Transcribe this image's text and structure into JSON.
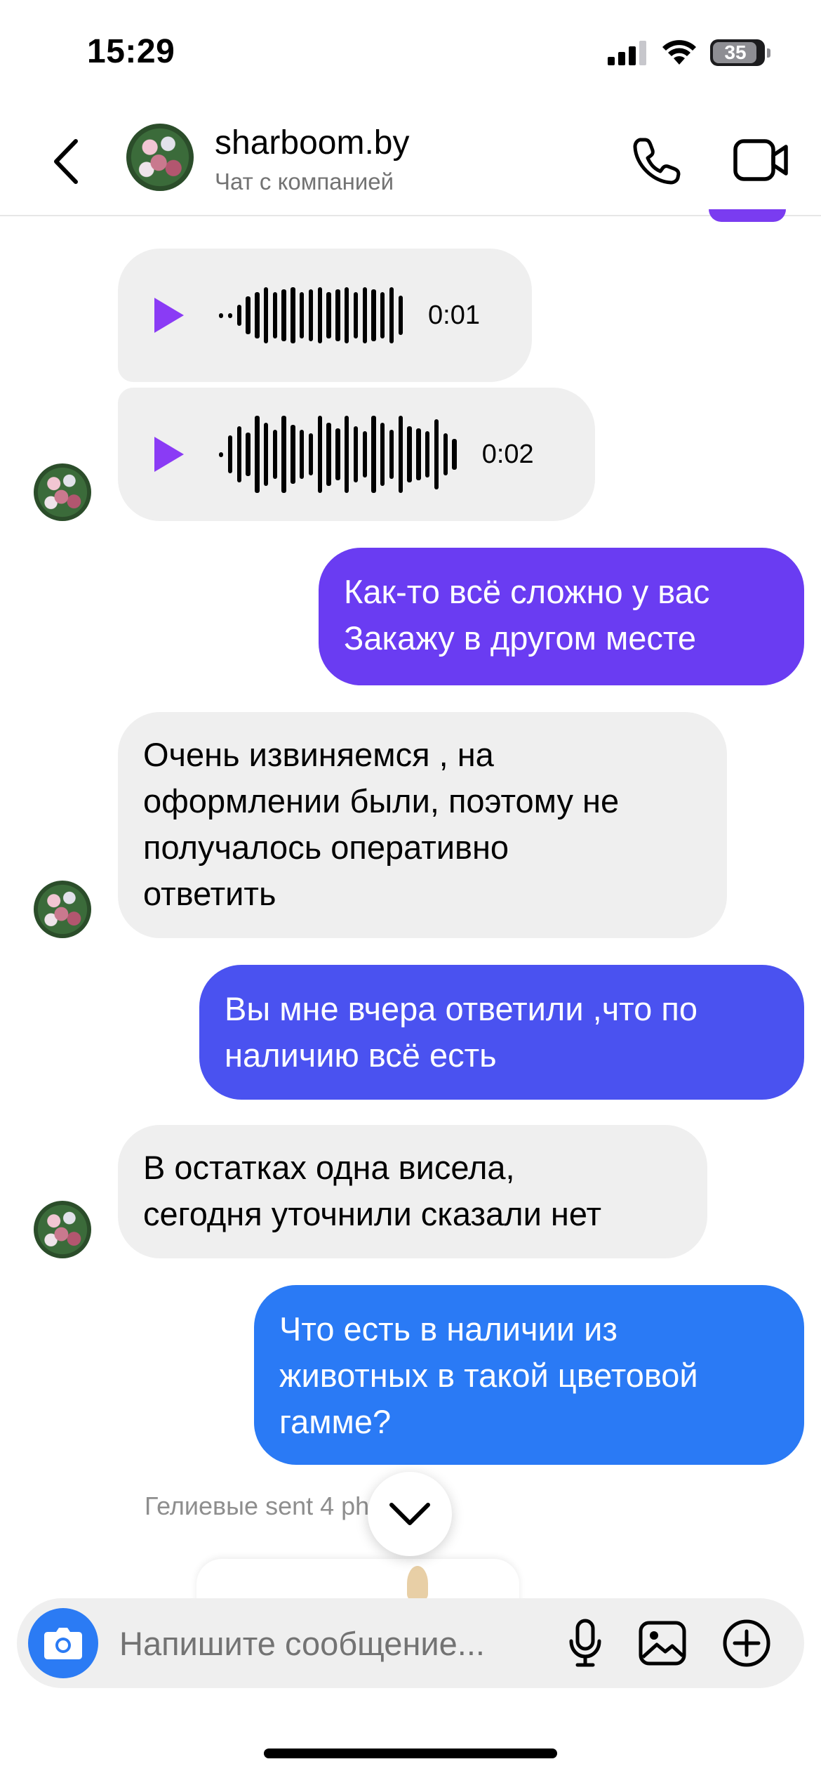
{
  "status_bar": {
    "time": "15:29",
    "battery_level": "35"
  },
  "header": {
    "name": "sharboom.by",
    "subtitle": "Чат с компанией"
  },
  "messages": [
    {
      "kind": "voice",
      "direction": "incoming",
      "duration": "0:01"
    },
    {
      "kind": "voice",
      "direction": "incoming",
      "duration": "0:02"
    },
    {
      "kind": "text",
      "direction": "outgoing",
      "text": "Как-то всё сложно у вас\nЗакажу в другом месте"
    },
    {
      "kind": "text",
      "direction": "incoming",
      "text": "Очень извиняемся , на\nоформлении были, поэтому не\nполучалось оперативно\nответить"
    },
    {
      "kind": "text",
      "direction": "outgoing",
      "text": "Вы мне вчера ответили ,что по\nналичию всё есть"
    },
    {
      "kind": "text",
      "direction": "incoming",
      "text": "В остатках одна висела,\nсегодня уточнили сказали нет"
    },
    {
      "kind": "text",
      "direction": "outgoing",
      "text": "Что есть в наличии из\nживотных в такой цветовой\nгамме?"
    }
  ],
  "sent_note": "Гелиевые sent 4 photos",
  "composer": {
    "placeholder": "Напишите сообщение..."
  },
  "colors": {
    "accent_purple": "#8a3bf5",
    "outgoing_gradient_top": "#6a3cf2",
    "outgoing_gradient_mid": "#4a52f0",
    "outgoing_gradient_bottom": "#2a7af5",
    "incoming_bubble": "#efefef",
    "camera_button": "#2b7bf4"
  },
  "icons": {
    "back": "chevron-left-icon",
    "call": "phone-icon",
    "video": "video-camera-icon",
    "play": "play-icon",
    "scroll_down": "chevron-down-icon",
    "camera": "camera-icon",
    "mic": "microphone-icon",
    "gallery": "image-icon",
    "plus": "plus-circle-icon"
  }
}
